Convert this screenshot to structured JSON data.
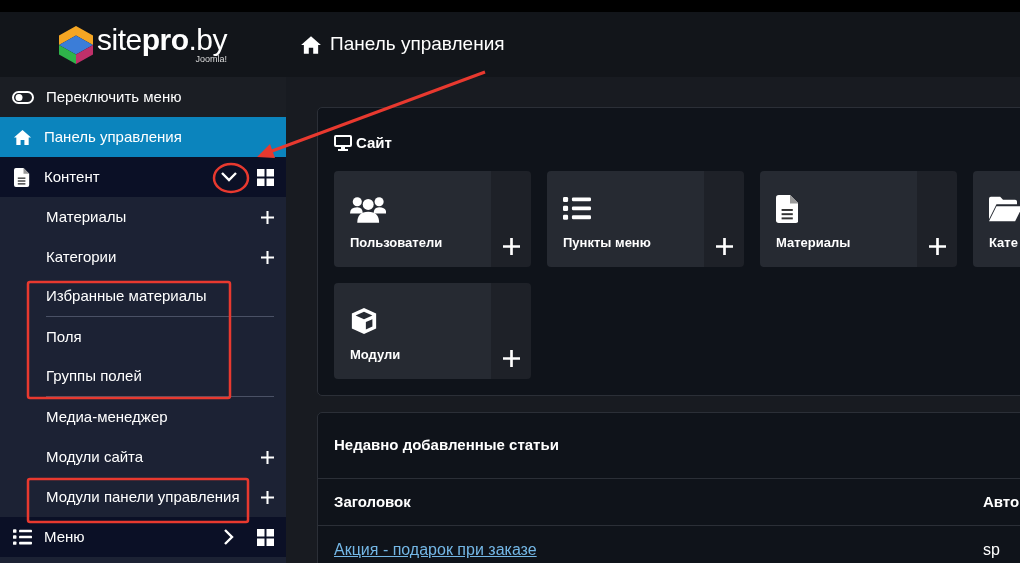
{
  "header": {
    "logo": {
      "text": "site**pro**.by",
      "sub": "Joomla!"
    },
    "title": "Панель управления"
  },
  "sidebar": {
    "toggle": {
      "label": "Переключить меню"
    },
    "items": [
      {
        "label": "Панель управления",
        "selected": true
      },
      {
        "label": "Контент",
        "selected": false,
        "expanded": true,
        "children": [
          {
            "label": "Материалы",
            "add": true,
            "separator": false
          },
          {
            "label": "Категории",
            "add": true,
            "separator": false
          },
          {
            "label": "Избранные материалы",
            "add": false,
            "separator": true
          },
          {
            "label": "Поля",
            "add": false,
            "separator": false
          },
          {
            "label": "Группы полей",
            "add": false,
            "separator": true
          },
          {
            "label": "Медиа-менеджер",
            "add": false,
            "separator": false
          },
          {
            "label": "Модули сайта",
            "add": true,
            "separator": false
          },
          {
            "label": "Модули панели управления",
            "add": true,
            "separator": false
          }
        ]
      },
      {
        "label": "Меню",
        "selected": false,
        "expanded": false
      }
    ]
  },
  "site_card": {
    "title": "Сайт",
    "tiles": [
      {
        "label": "Пользователи"
      },
      {
        "label": "Пункты меню"
      },
      {
        "label": "Материалы"
      },
      {
        "label": "Кате"
      },
      {
        "label": "Модули"
      }
    ]
  },
  "articles": {
    "title": "Недавно добавленные статьи",
    "columns": [
      "Заголовок",
      "Авто"
    ],
    "rows": [
      [
        "Акция - подарок при заказе",
        "sp"
      ]
    ]
  }
}
